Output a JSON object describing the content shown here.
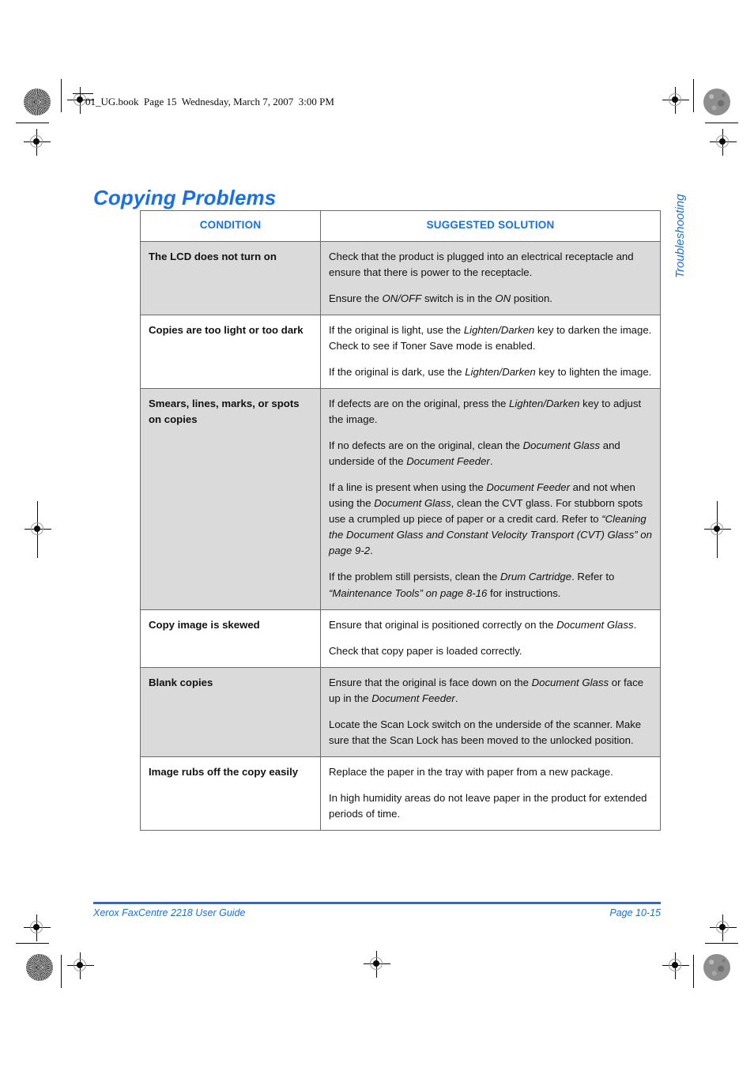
{
  "running_header": {
    "text": "01_UG.book  Page 15  Wednesday, March 7, 2007  3:00 PM"
  },
  "page_title": "Copying Problems",
  "side_tab": "Troubleshooting",
  "table": {
    "headers": {
      "condition": "CONDITION",
      "solution": "SUGGESTED SOLUTION"
    },
    "rows": [
      {
        "condition": "The LCD does not turn on",
        "shaded": true,
        "paragraphs": [
          [
            {
              "t": "Check that the product is plugged into an electrical receptacle and ensure that there is power to the receptacle.",
              "i": false
            }
          ],
          [
            {
              "t": "Ensure the ",
              "i": false
            },
            {
              "t": "ON/OFF",
              "i": true
            },
            {
              "t": " switch is in the ",
              "i": false
            },
            {
              "t": "ON",
              "i": true
            },
            {
              "t": " position.",
              "i": false
            }
          ]
        ]
      },
      {
        "condition": "Copies are too light or too dark",
        "shaded": false,
        "paragraphs": [
          [
            {
              "t": "If the original is light, use the ",
              "i": false
            },
            {
              "t": "Lighten/Darken",
              "i": true
            },
            {
              "t": " key to darken the image. Check to see if Toner Save mode is enabled.",
              "i": false
            }
          ],
          [
            {
              "t": "If the original is dark, use the ",
              "i": false
            },
            {
              "t": "Lighten/Darken",
              "i": true
            },
            {
              "t": " key to lighten the image.",
              "i": false
            }
          ]
        ]
      },
      {
        "condition": "Smears, lines, marks, or spots on copies",
        "shaded": true,
        "paragraphs": [
          [
            {
              "t": "If defects are on the original, press the ",
              "i": false
            },
            {
              "t": "Lighten/Darken",
              "i": true
            },
            {
              "t": " key to adjust the image.",
              "i": false
            }
          ],
          [
            {
              "t": "If no defects are on the original, clean the ",
              "i": false
            },
            {
              "t": "Document Glass",
              "i": true
            },
            {
              "t": " and underside of the ",
              "i": false
            },
            {
              "t": "Document Feeder",
              "i": true
            },
            {
              "t": ".",
              "i": false
            }
          ],
          [
            {
              "t": "If a line is present when using the ",
              "i": false
            },
            {
              "t": "Document Feeder",
              "i": true
            },
            {
              "t": " and not when using the ",
              "i": false
            },
            {
              "t": "Document Glass",
              "i": true
            },
            {
              "t": ", clean the CVT glass. For stubborn spots use a crumpled up piece of paper or a credit card. Refer to ",
              "i": false
            },
            {
              "t": "“Cleaning the Document Glass and Constant Velocity Transport (CVT) Glass” on page 9-2",
              "i": true
            },
            {
              "t": ".",
              "i": false
            }
          ],
          [
            {
              "t": "If the problem still persists, clean the ",
              "i": false
            },
            {
              "t": "Drum Cartridge",
              "i": true
            },
            {
              "t": ". Refer to ",
              "i": false
            },
            {
              "t": "“Maintenance Tools” on page 8-16",
              "i": true
            },
            {
              "t": " for instructions.",
              "i": false
            }
          ]
        ]
      },
      {
        "condition": "Copy image is skewed",
        "shaded": false,
        "paragraphs": [
          [
            {
              "t": "Ensure that original is positioned correctly on the ",
              "i": false
            },
            {
              "t": "Document Glass",
              "i": true
            },
            {
              "t": ".",
              "i": false
            }
          ],
          [
            {
              "t": "Check that copy paper is loaded correctly.",
              "i": false
            }
          ]
        ]
      },
      {
        "condition": "Blank copies",
        "shaded": true,
        "paragraphs": [
          [
            {
              "t": "Ensure that the original is face down on the ",
              "i": false
            },
            {
              "t": "Document Glass",
              "i": true
            },
            {
              "t": " or face up in the ",
              "i": false
            },
            {
              "t": "Document Feeder",
              "i": true
            },
            {
              "t": ".",
              "i": false
            }
          ],
          [
            {
              "t": "Locate the Scan Lock switch on the underside of the scanner. Make sure that the Scan Lock has been moved to the unlocked position.",
              "i": false
            }
          ]
        ]
      },
      {
        "condition": "Image rubs off the copy easily",
        "shaded": false,
        "paragraphs": [
          [
            {
              "t": "Replace the paper in the tray with paper from a new package.",
              "i": false
            }
          ],
          [
            {
              "t": "In high humidity areas do not leave paper in the product for extended periods of time.",
              "i": false
            }
          ]
        ]
      }
    ]
  },
  "footer": {
    "left": "Xerox FaxCentre 2218 User Guide",
    "right": "Page 10-15"
  },
  "colors": {
    "accent_blue": "#1a6fe8",
    "row_shade": "#dadada",
    "border": "#6b6b6b",
    "text": "#121212"
  }
}
